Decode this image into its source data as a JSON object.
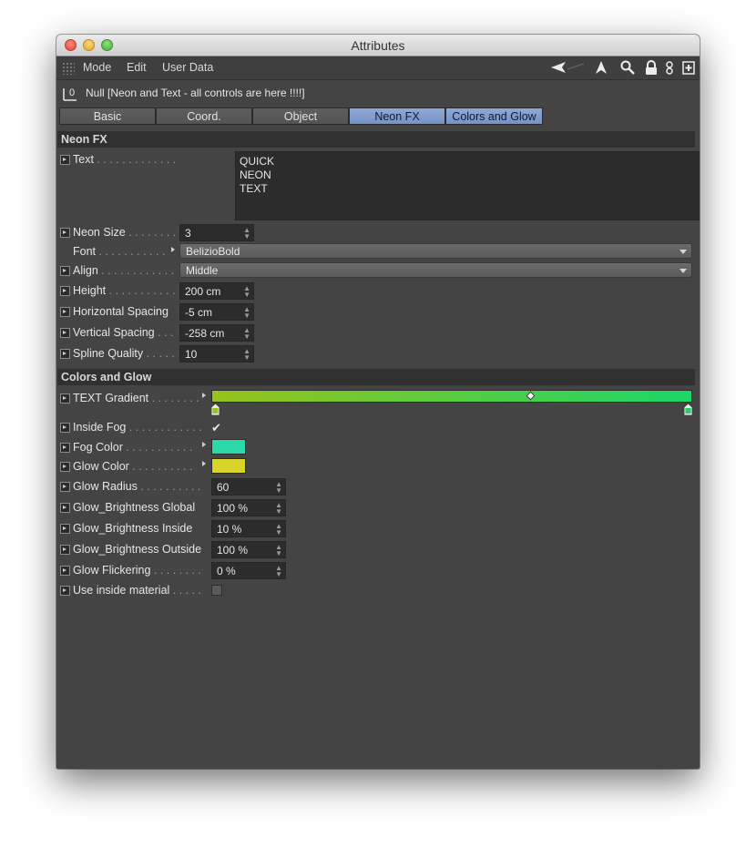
{
  "window": {
    "title": "Attributes"
  },
  "menu": {
    "mode": "Mode",
    "edit": "Edit",
    "user_data": "User Data"
  },
  "object": {
    "label": "Null [Neon and Text - all controls are here !!!!]"
  },
  "tabs": [
    {
      "label": "Basic"
    },
    {
      "label": "Coord."
    },
    {
      "label": "Object"
    },
    {
      "label": "Neon FX"
    },
    {
      "label": "Colors and Glow"
    }
  ],
  "neon_fx": {
    "heading": "Neon FX",
    "text": {
      "label": "Text",
      "value_lines": [
        "QUICK",
        "NEON",
        "TEXT"
      ]
    },
    "neon_size": {
      "label": "Neon Size",
      "value": "3"
    },
    "font": {
      "label": "Font",
      "value": "BelizioBold"
    },
    "align": {
      "label": "Align",
      "value": "Middle"
    },
    "height": {
      "label": "Height",
      "value": "200 cm"
    },
    "horizontal_spacing": {
      "label": "Horizontal Spacing",
      "value": "-5 cm"
    },
    "vertical_spacing": {
      "label": "Vertical Spacing",
      "value": "-258 cm"
    },
    "spline_quality": {
      "label": "Spline Quality",
      "value": "10"
    }
  },
  "colors_glow": {
    "heading": "Colors and Glow",
    "text_gradient": {
      "label": "TEXT Gradient",
      "start_color": "#98c21a",
      "end_color": "#1ad668"
    },
    "inside_fog": {
      "label": "Inside Fog",
      "checked": true
    },
    "fog_color": {
      "label": "Fog Color",
      "color": "#2bd8a7"
    },
    "glow_color": {
      "label": "Glow Color",
      "color": "#d8d42b"
    },
    "glow_radius": {
      "label": "Glow Radius",
      "value": "60"
    },
    "glow_brightness_global": {
      "label": "Glow_Brightness Global",
      "value": "100 %"
    },
    "glow_brightness_inside": {
      "label": "Glow_Brightness Inside",
      "value": "10 %"
    },
    "glow_brightness_outside": {
      "label": "Glow_Brightness Outside",
      "value": "100 %"
    },
    "glow_flickering": {
      "label": "Glow Flickering",
      "value": "0 %"
    },
    "use_inside_material": {
      "label": "Use inside material",
      "checked": false
    }
  },
  "colors": {
    "active_tab": "#7f9bcc",
    "panel_bg": "#444444"
  }
}
